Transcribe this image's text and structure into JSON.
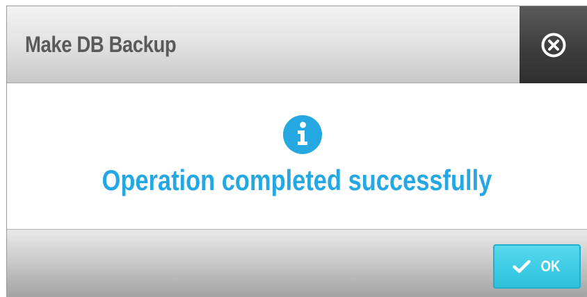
{
  "dialog": {
    "title": "Make DB Backup",
    "close_icon": "close-circle-icon",
    "info_icon": "info-icon",
    "message": "Operation completed successfully",
    "ok_icon": "checkmark-icon",
    "ok_label": "OK"
  },
  "colors": {
    "accent": "#25a7e2",
    "ok_button": "#3fcde6",
    "close_button_bg": "#3d3d3d",
    "title_text": "#5a5a5a"
  }
}
